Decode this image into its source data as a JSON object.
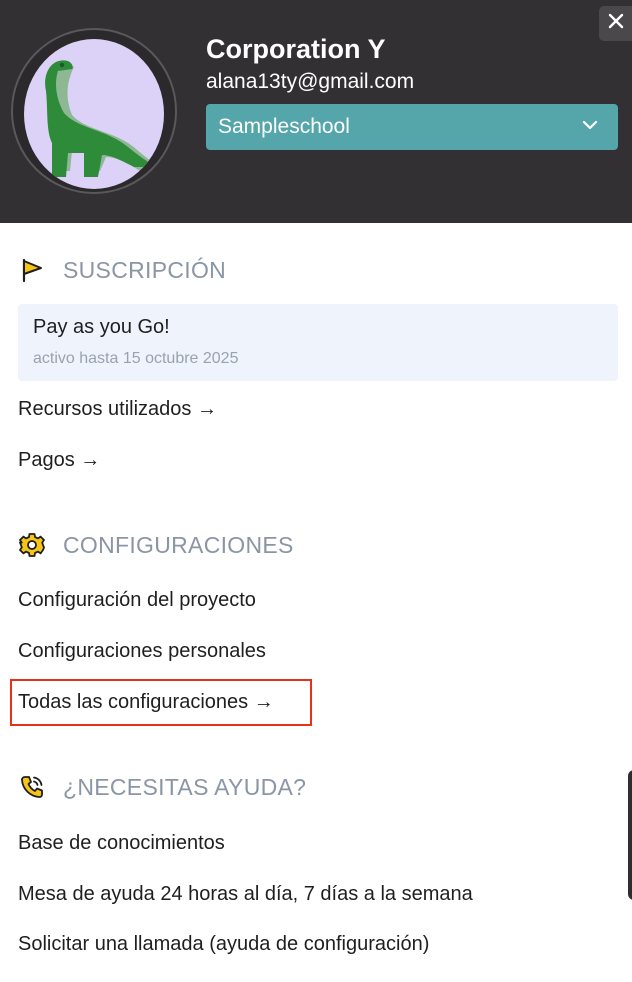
{
  "header": {
    "org_name": "Corporation Y",
    "email": "alana13ty@gmail.com",
    "school_select": {
      "selected": "Sampleschool"
    },
    "close_label": "✕",
    "colors": {
      "background": "#323032",
      "select": "#55a6aa",
      "avatar_bg": "#dcd1f6",
      "dino": "#2e8b3a"
    }
  },
  "subscription": {
    "icon": "flag-icon",
    "title": "SUSCRIPCIÓN",
    "plan_name": "Pay as you Go!",
    "plan_status": "activo hasta 15 octubre 2025",
    "links": [
      {
        "label": "Recursos utilizados →"
      },
      {
        "label": "Pagos →"
      }
    ]
  },
  "settings": {
    "icon": "gear-icon",
    "title": "CONFIGURACIONES",
    "links": [
      {
        "label": "Configuración del proyecto"
      },
      {
        "label": "Configuraciones personales"
      },
      {
        "label": "Todas las configuraciones →",
        "highlighted": true
      }
    ],
    "highlight_color": "#e53218"
  },
  "help": {
    "icon": "phone-ringing-icon",
    "title": "¿NECESITAS AYUDA?",
    "links": [
      {
        "label": "Base de conocimientos"
      },
      {
        "label": "Mesa de ayuda 24 horas al día, 7 días a la semana"
      },
      {
        "label": "Solicitar una llamada (ayuda de configuración)"
      }
    ]
  }
}
